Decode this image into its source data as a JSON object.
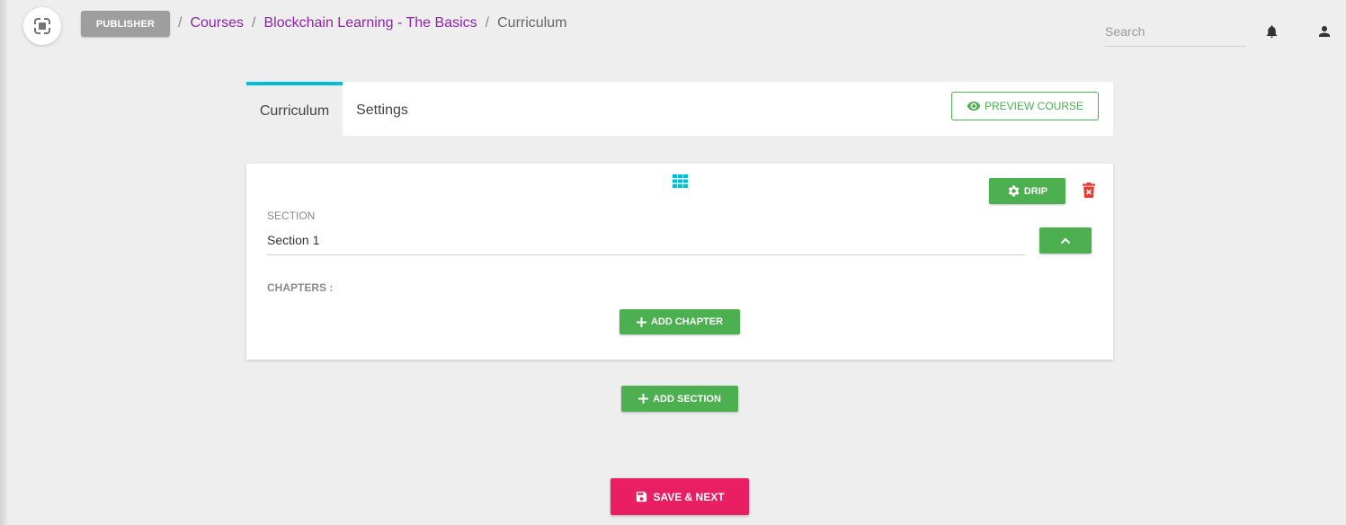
{
  "header": {
    "publisher_label": "PUBLISHER",
    "breadcrumb": {
      "separator": "/",
      "items": [
        "Courses",
        "Blockchain Learning - The Basics"
      ],
      "current": "Curriculum"
    },
    "search": {
      "placeholder": "Search",
      "value": ""
    },
    "icons": {
      "logo": "logo-icon",
      "notifications": "bell-icon",
      "account": "user-icon"
    }
  },
  "tabs": {
    "items": [
      {
        "label": "Curriculum",
        "active": true
      },
      {
        "label": "Settings",
        "active": false
      }
    ],
    "preview_label": "PREVIEW COURSE"
  },
  "section": {
    "drip_label": "DRIP",
    "section_label": "SECTION",
    "section_value": "Section 1",
    "chapters_label": "CHAPTERS :",
    "add_chapter_label": "ADD CHAPTER"
  },
  "actions": {
    "add_section_label": "ADD SECTION",
    "save_next_label": "SAVE & NEXT"
  },
  "colors": {
    "accent_cyan": "#00bcd4",
    "success_green": "#4caf50",
    "link_purple": "#8e24aa",
    "save_pink": "#e91e63",
    "danger_red": "#e53935"
  }
}
